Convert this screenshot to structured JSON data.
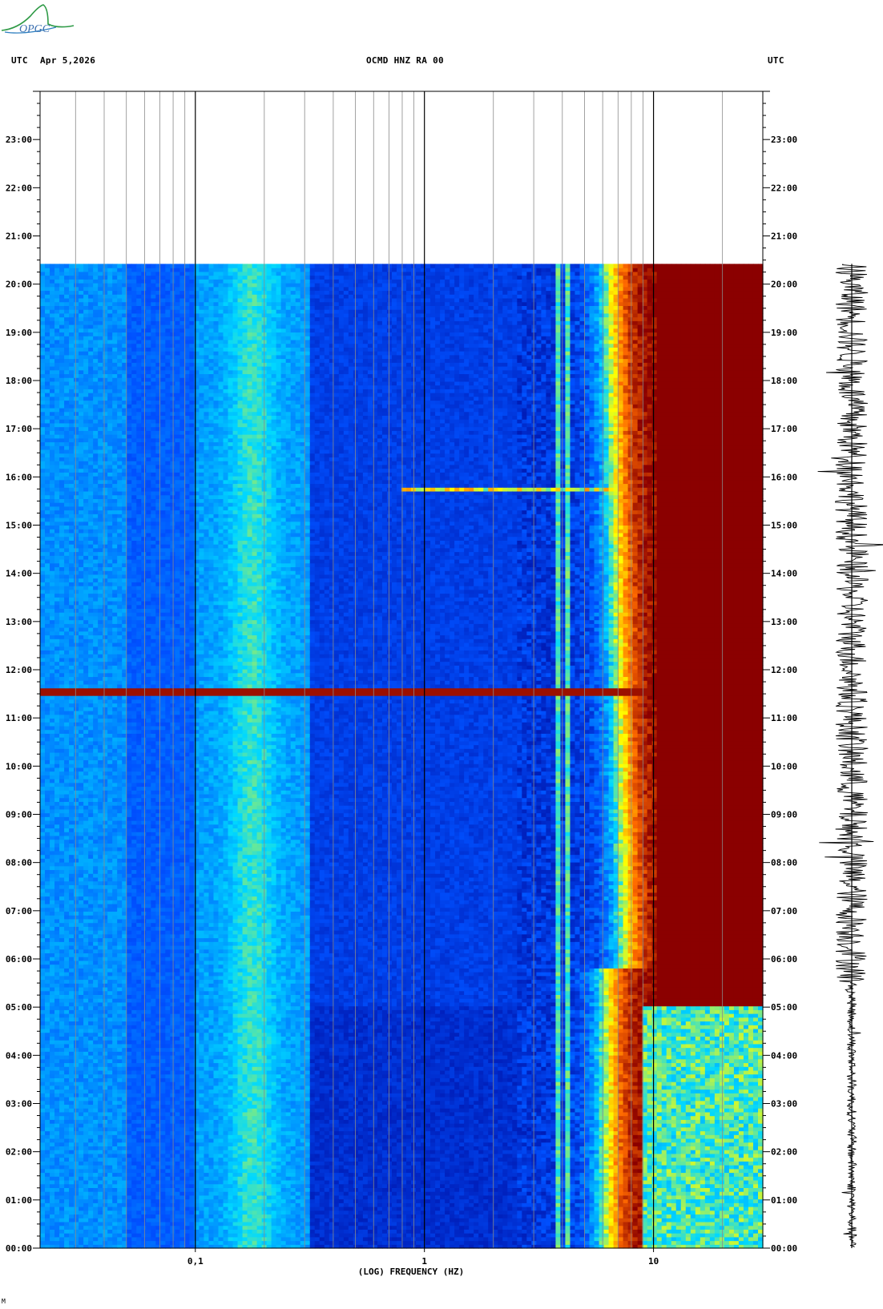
{
  "header": {
    "left_utc": "UTC",
    "date": "Apr 5,2026",
    "station": "OCMD HNZ RA 00",
    "right_utc": "UTC"
  },
  "logo": {
    "text": "OPGC",
    "icon": "mountain-swoosh-icon"
  },
  "footnote": "M",
  "chart_data": {
    "type": "heatmap",
    "title": "OCMD HNZ RA 00",
    "xlabel": "(LOG) FREQUENCY (HZ)",
    "x_scale": "log",
    "xlim": [
      0.021,
      30
    ],
    "x_ticks": [
      {
        "value": 0.1,
        "label": "0,1"
      },
      {
        "value": 1,
        "label": "1"
      },
      {
        "value": 10,
        "label": "10"
      }
    ],
    "ylim_hours": [
      0,
      24
    ],
    "y_ticks_left": [
      "00:00",
      "01:00",
      "02:00",
      "03:00",
      "04:00",
      "05:00",
      "06:00",
      "07:00",
      "08:00",
      "09:00",
      "10:00",
      "11:00",
      "12:00",
      "13:00",
      "14:00",
      "15:00",
      "16:00",
      "17:00",
      "18:00",
      "19:00",
      "20:00",
      "21:00",
      "22:00",
      "23:00"
    ],
    "y_ticks_right": [
      "00:00",
      "01:00",
      "02:00",
      "03:00",
      "04:00",
      "05:00",
      "06:00",
      "07:00",
      "08:00",
      "09:00",
      "10:00",
      "11:00",
      "12:00",
      "13:00",
      "14:00",
      "15:00",
      "16:00",
      "17:00",
      "18:00",
      "19:00",
      "20:00",
      "21:00",
      "22:00",
      "23:00"
    ],
    "data_end_hour": 20.42,
    "colormap": [
      "#00008f",
      "#0050ff",
      "#00d8ff",
      "#ffff00",
      "#ff6a00",
      "#8b0000"
    ],
    "no_data_color": "#ffffff",
    "events": [
      {
        "time_hour": 15.75,
        "freq_range_hz": [
          0.8,
          7
        ],
        "description": "horizontal energy streak"
      },
      {
        "time_hour": 11.55,
        "freq_range_hz": [
          0.021,
          10
        ],
        "description": "broadband spike"
      }
    ],
    "spectral_lines_hz": [
      3.8,
      4.2
    ],
    "high_noise_band_hz": [
      8,
      30
    ],
    "quiet_period_hours": [
      0,
      5
    ]
  },
  "seismogram": {
    "description": "24h trace",
    "amplitude_night": 0.25,
    "amplitude_day": 0.85
  }
}
